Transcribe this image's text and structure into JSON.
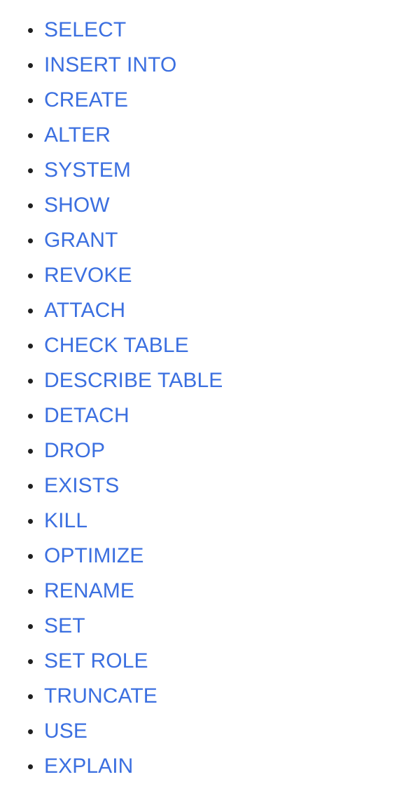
{
  "page": {
    "background_color": "#ffffff",
    "link_color": "#3B6FE0",
    "bullet_color": "#202020",
    "list_style": "disc"
  },
  "list": {
    "items": [
      {
        "label": "SELECT"
      },
      {
        "label": "INSERT INTO"
      },
      {
        "label": "CREATE"
      },
      {
        "label": "ALTER"
      },
      {
        "label": "SYSTEM"
      },
      {
        "label": "SHOW"
      },
      {
        "label": "GRANT"
      },
      {
        "label": "REVOKE"
      },
      {
        "label": "ATTACH"
      },
      {
        "label": "CHECK TABLE"
      },
      {
        "label": "DESCRIBE TABLE"
      },
      {
        "label": "DETACH"
      },
      {
        "label": "DROP"
      },
      {
        "label": "EXISTS"
      },
      {
        "label": "KILL"
      },
      {
        "label": "OPTIMIZE"
      },
      {
        "label": "RENAME"
      },
      {
        "label": "SET"
      },
      {
        "label": "SET ROLE"
      },
      {
        "label": "TRUNCATE"
      },
      {
        "label": "USE"
      },
      {
        "label": "EXPLAIN"
      }
    ]
  }
}
